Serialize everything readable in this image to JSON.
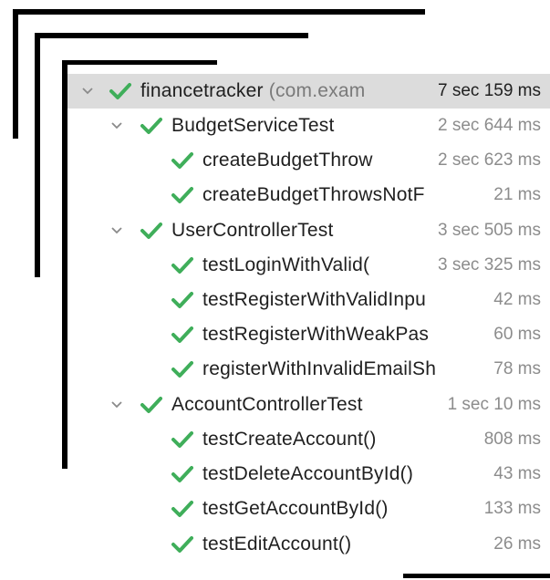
{
  "colors": {
    "check": "#3fae5a",
    "selected_bg": "#dcdcdc",
    "muted": "#8c8c8c"
  },
  "icons": {
    "expand": "chevron-down-icon",
    "passed": "check-icon"
  },
  "root": {
    "name": "financetracker",
    "package": "(com.exam",
    "time": "7 sec 159 ms"
  },
  "suites": [
    {
      "name": "BudgetServiceTest",
      "time": "2 sec 644 ms",
      "tests": [
        {
          "name": "createBudgetThrow",
          "time": "2 sec 623 ms"
        },
        {
          "name": "createBudgetThrowsNotF",
          "time": "21 ms"
        }
      ]
    },
    {
      "name": "UserControllerTest",
      "time": "3 sec 505 ms",
      "tests": [
        {
          "name": "testLoginWithValid(",
          "time": "3 sec 325 ms"
        },
        {
          "name": "testRegisterWithValidInpu",
          "time": "42 ms"
        },
        {
          "name": "testRegisterWithWeakPas",
          "time": "60 ms"
        },
        {
          "name": "registerWithInvalidEmailSh",
          "time": "78 ms"
        }
      ]
    },
    {
      "name": "AccountControllerTest",
      "time": "1 sec 10 ms",
      "tests": [
        {
          "name": "testCreateAccount()",
          "time": "808 ms"
        },
        {
          "name": "testDeleteAccountById()",
          "time": "43 ms"
        },
        {
          "name": "testGetAccountById()",
          "time": "133 ms"
        },
        {
          "name": "testEditAccount()",
          "time": "26 ms"
        }
      ]
    }
  ]
}
